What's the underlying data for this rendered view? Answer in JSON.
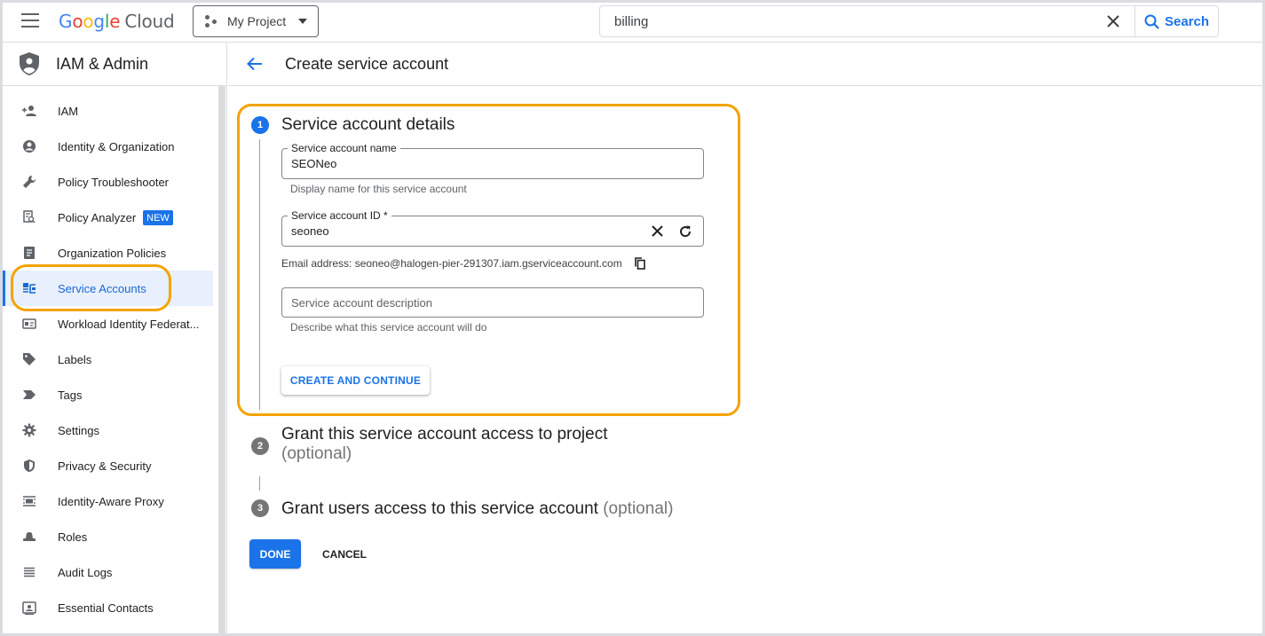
{
  "header": {
    "logo_letters": [
      "G",
      "o",
      "o",
      "g",
      "l",
      "e"
    ],
    "logo_product": "Cloud",
    "project": "My Project",
    "search_value": "billing",
    "search_button": "Search"
  },
  "sidebar": {
    "title": "IAM & Admin",
    "items": [
      {
        "label": "IAM",
        "icon": "person-add-icon"
      },
      {
        "label": "Identity & Organization",
        "icon": "account-circle-icon"
      },
      {
        "label": "Policy Troubleshooter",
        "icon": "wrench-icon"
      },
      {
        "label": "Policy Analyzer",
        "icon": "document-search-icon",
        "badge": "NEW"
      },
      {
        "label": "Organization Policies",
        "icon": "list-document-icon"
      },
      {
        "label": "Service Accounts",
        "icon": "service-account-icon",
        "active": true
      },
      {
        "label": "Workload Identity Federat...",
        "icon": "id-card-icon"
      },
      {
        "label": "Labels",
        "icon": "label-tag-icon"
      },
      {
        "label": "Tags",
        "icon": "tag-arrow-icon"
      },
      {
        "label": "Settings",
        "icon": "gear-icon"
      },
      {
        "label": "Privacy & Security",
        "icon": "shield-icon"
      },
      {
        "label": "Identity-Aware Proxy",
        "icon": "proxy-icon"
      },
      {
        "label": "Roles",
        "icon": "hat-icon"
      },
      {
        "label": "Audit Logs",
        "icon": "list-lines-icon"
      },
      {
        "label": "Essential Contacts",
        "icon": "contact-card-icon"
      }
    ]
  },
  "main": {
    "page_title": "Create service account",
    "step1": {
      "number": "1",
      "title": "Service account details",
      "name_label": "Service account name",
      "name_value": "SEONeo",
      "name_hint": "Display name for this service account",
      "id_label": "Service account ID *",
      "id_value": "seoneo",
      "email_line": "Email address: seoneo@halogen-pier-291307.iam.gserviceaccount.com",
      "description_placeholder": "Service account description",
      "description_hint": "Describe what this service account will do",
      "create_button": "CREATE AND CONTINUE"
    },
    "step2": {
      "number": "2",
      "title": "Grant this service account access to project",
      "optional": "(optional)"
    },
    "step3": {
      "number": "3",
      "title": "Grant users access to this service account",
      "optional": "(optional)"
    },
    "done_button": "DONE",
    "cancel_button": "CANCEL"
  },
  "colors": {
    "accent": "#1a73e8",
    "highlight": "#f4a300",
    "step_inactive": "#757575"
  }
}
